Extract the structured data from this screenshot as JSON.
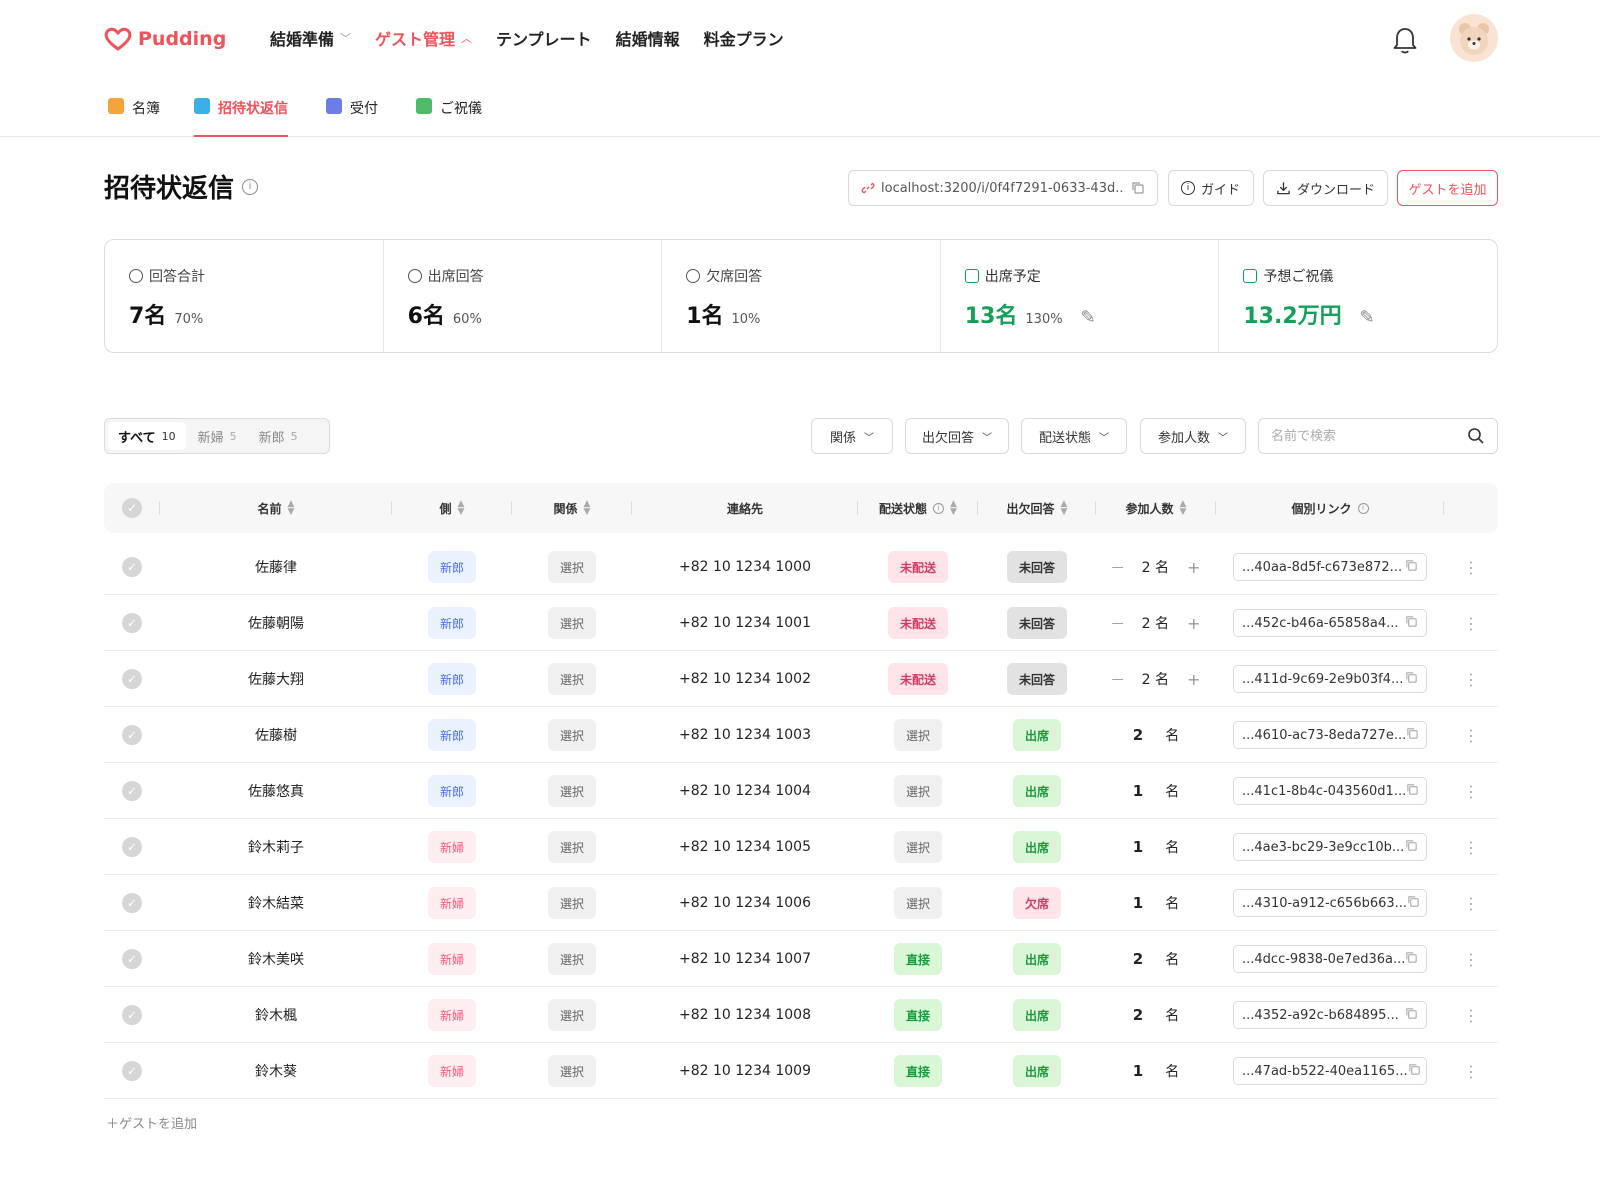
{
  "brand": {
    "name": "Pudding",
    "accent": "#f0525a"
  },
  "nav": [
    {
      "label": "結婚準備",
      "chevron": "down",
      "active": false
    },
    {
      "label": "ゲスト管理",
      "chevron": "up",
      "active": true
    },
    {
      "label": "テンプレート",
      "chevron": "",
      "active": false
    },
    {
      "label": "結婚情報",
      "chevron": "",
      "active": false
    },
    {
      "label": "料金プラン",
      "chevron": "",
      "active": false
    }
  ],
  "subtabs": [
    {
      "label": "名簿",
      "icon": "register-icon",
      "active": false
    },
    {
      "label": "招待状返信",
      "icon": "invitation-icon",
      "active": true
    },
    {
      "label": "受付",
      "icon": "reception-icon",
      "active": false
    },
    {
      "label": "ご祝儀",
      "icon": "gift-money-icon",
      "active": false
    }
  ],
  "page": {
    "title": "招待状返信",
    "share_link": "localhost:3200/i/0f4f7291-0633-43d...",
    "guide_label": "ガイド",
    "download_label": "ダウンロード",
    "add_guest_label": "ゲストを追加"
  },
  "stats": [
    {
      "label": "回答合計",
      "value": "7名",
      "pct": "70%",
      "green": false,
      "editable": false,
      "icon": "chat-bubble-icon"
    },
    {
      "label": "出席回答",
      "value": "6名",
      "pct": "60%",
      "green": false,
      "editable": false,
      "icon": "check-circle-icon"
    },
    {
      "label": "欠席回答",
      "value": "1名",
      "pct": "10%",
      "green": false,
      "editable": false,
      "icon": "x-circle-icon"
    },
    {
      "label": "出席予定",
      "value": "13名",
      "pct": "130%",
      "green": true,
      "editable": true,
      "icon": "trend-up-icon"
    },
    {
      "label": "予想ご祝儀",
      "value": "13.2万円",
      "pct": "",
      "green": true,
      "editable": true,
      "icon": "wallet-icon"
    }
  ],
  "segments": [
    {
      "label": "すべて",
      "count": "10",
      "active": true
    },
    {
      "label": "新婦",
      "count": "5",
      "active": false
    },
    {
      "label": "新郎",
      "count": "5",
      "active": false
    }
  ],
  "filters": {
    "relation": "関係",
    "attendance": "出欠回答",
    "delivery": "配送状態",
    "headcount": "参加人数",
    "search_placeholder": "名前で検索"
  },
  "columns": {
    "name": "名前",
    "side": "側",
    "relation": "関係",
    "contact": "連絡先",
    "delivery": "配送状態",
    "attendance": "出欠回答",
    "headcount": "参加人数",
    "link": "個別リンク"
  },
  "rows": [
    {
      "name": "佐藤律",
      "side": "新郎",
      "side_type": "groom",
      "relation": "選択",
      "contact": "+82 10 1234 1000",
      "delivery": "未配送",
      "delivery_type": "undelivered",
      "attendance": "未回答",
      "attendance_type": "noreply",
      "count": "2",
      "unit": "名",
      "stepper": true,
      "link": "...40aa-8d5f-c673e872..."
    },
    {
      "name": "佐藤朝陽",
      "side": "新郎",
      "side_type": "groom",
      "relation": "選択",
      "contact": "+82 10 1234 1001",
      "delivery": "未配送",
      "delivery_type": "undelivered",
      "attendance": "未回答",
      "attendance_type": "noreply",
      "count": "2",
      "unit": "名",
      "stepper": true,
      "link": "...452c-b46a-65858a4..."
    },
    {
      "name": "佐藤大翔",
      "side": "新郎",
      "side_type": "groom",
      "relation": "選択",
      "contact": "+82 10 1234 1002",
      "delivery": "未配送",
      "delivery_type": "undelivered",
      "attendance": "未回答",
      "attendance_type": "noreply",
      "count": "2",
      "unit": "名",
      "stepper": true,
      "link": "...411d-9c69-2e9b03f4..."
    },
    {
      "name": "佐藤樹",
      "side": "新郎",
      "side_type": "groom",
      "relation": "選択",
      "contact": "+82 10 1234 1003",
      "delivery": "選択",
      "delivery_type": "neutral",
      "attendance": "出席",
      "attendance_type": "attend",
      "count": "2",
      "unit": "名",
      "stepper": false,
      "link": "...4610-ac73-8eda727e..."
    },
    {
      "name": "佐藤悠真",
      "side": "新郎",
      "side_type": "groom",
      "relation": "選択",
      "contact": "+82 10 1234 1004",
      "delivery": "選択",
      "delivery_type": "neutral",
      "attendance": "出席",
      "attendance_type": "attend",
      "count": "1",
      "unit": "名",
      "stepper": false,
      "link": "...41c1-8b4c-043560d1..."
    },
    {
      "name": "鈴木莉子",
      "side": "新婦",
      "side_type": "bride",
      "relation": "選択",
      "contact": "+82 10 1234 1005",
      "delivery": "選択",
      "delivery_type": "neutral",
      "attendance": "出席",
      "attendance_type": "attend",
      "count": "1",
      "unit": "名",
      "stepper": false,
      "link": "...4ae3-bc29-3e9cc10b..."
    },
    {
      "name": "鈴木結菜",
      "side": "新婦",
      "side_type": "bride",
      "relation": "選択",
      "contact": "+82 10 1234 1006",
      "delivery": "選択",
      "delivery_type": "neutral",
      "attendance": "欠席",
      "attendance_type": "absent",
      "count": "1",
      "unit": "名",
      "stepper": false,
      "link": "...4310-a912-c656b663..."
    },
    {
      "name": "鈴木美咲",
      "side": "新婦",
      "side_type": "bride",
      "relation": "選択",
      "contact": "+82 10 1234 1007",
      "delivery": "直接",
      "delivery_type": "direct",
      "attendance": "出席",
      "attendance_type": "attend",
      "count": "2",
      "unit": "名",
      "stepper": false,
      "link": "...4dcc-9838-0e7ed36a..."
    },
    {
      "name": "鈴木楓",
      "side": "新婦",
      "side_type": "bride",
      "relation": "選択",
      "contact": "+82 10 1234 1008",
      "delivery": "直接",
      "delivery_type": "direct",
      "attendance": "出席",
      "attendance_type": "attend",
      "count": "2",
      "unit": "名",
      "stepper": false,
      "link": "...4352-a92c-b684895..."
    },
    {
      "name": "鈴木葵",
      "side": "新婦",
      "side_type": "bride",
      "relation": "選択",
      "contact": "+82 10 1234 1009",
      "delivery": "直接",
      "delivery_type": "direct",
      "attendance": "出席",
      "attendance_type": "attend",
      "count": "1",
      "unit": "名",
      "stepper": false,
      "link": "...47ad-b522-40ea1165..."
    }
  ],
  "add_guest_footer": "＋ゲストを追加"
}
